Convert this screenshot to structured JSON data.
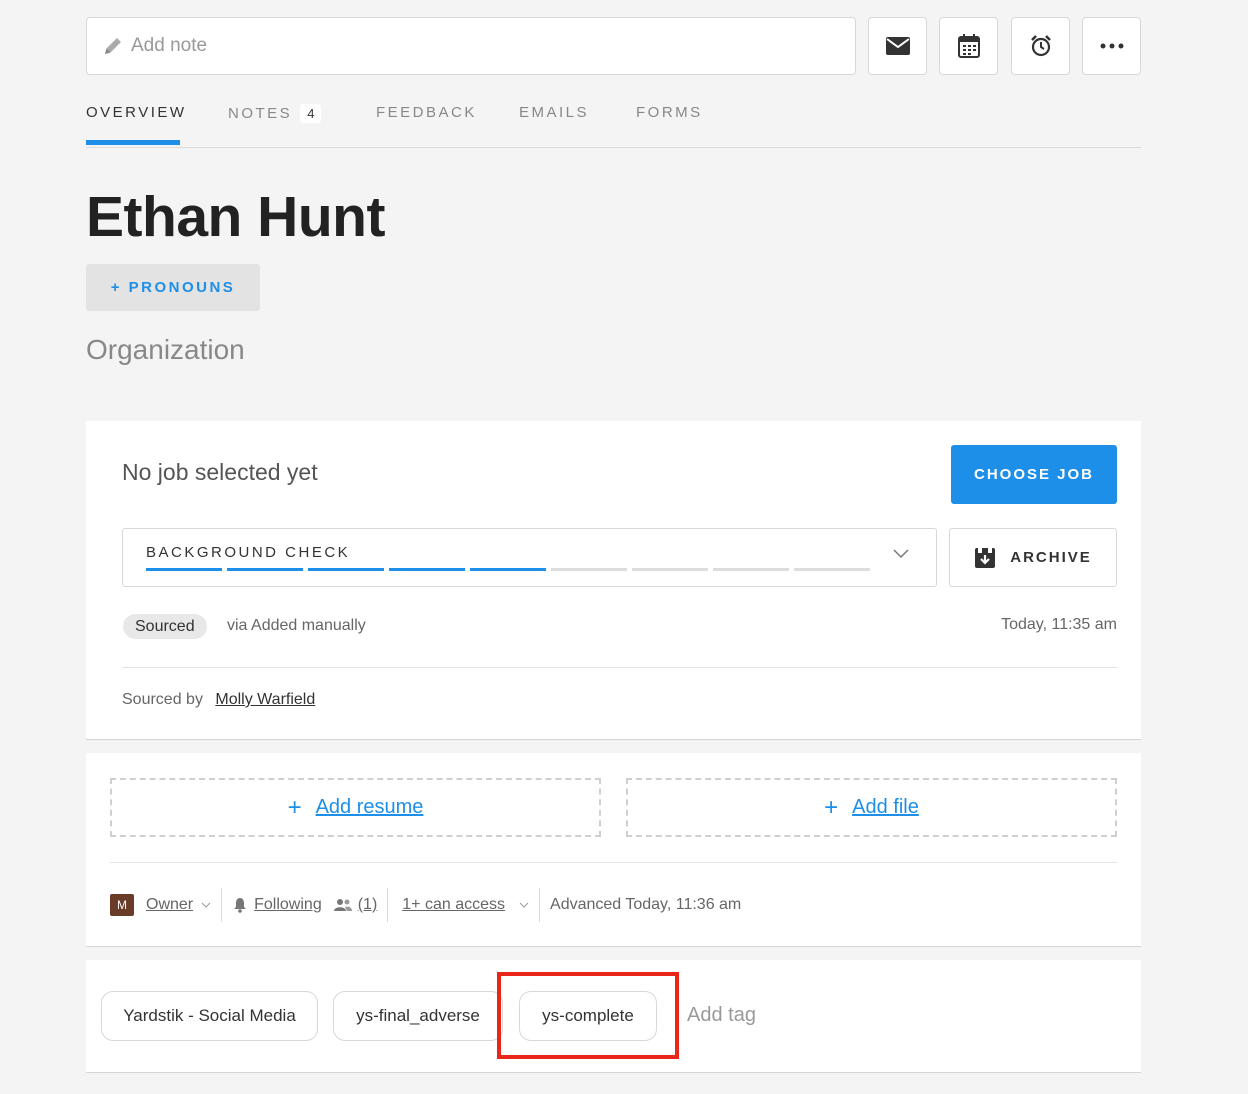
{
  "note_bar": {
    "placeholder": "Add note"
  },
  "toolbar": {
    "icons": [
      "email-icon",
      "calendar-icon",
      "alarm-icon",
      "more-icon"
    ]
  },
  "tabs": [
    {
      "label": "OVERVIEW",
      "active": true
    },
    {
      "label": "NOTES",
      "count": "4"
    },
    {
      "label": "FEEDBACK"
    },
    {
      "label": "EMAILS"
    },
    {
      "label": "FORMS"
    }
  ],
  "profile": {
    "name": "Ethan Hunt",
    "pronouns_button": "+ PRONOUNS",
    "organization": "Organization"
  },
  "job": {
    "status_text": "No job selected yet",
    "choose_button": "CHOOSE JOB",
    "stage_label": "BACKGROUND CHECK",
    "stage_progress": {
      "completed": 5,
      "total": 9
    },
    "archive_button": "ARCHIVE",
    "source_badge": "Sourced",
    "source_via": "via Added manually",
    "source_time": "Today, 11:35 am",
    "sourced_by_label": "Sourced by",
    "sourced_by_name": "Molly Warfield"
  },
  "files": {
    "add_resume": "Add resume",
    "add_file": "Add file"
  },
  "meta": {
    "avatar_initial": "M",
    "owner": "Owner",
    "following": "Following",
    "followers_count": "(1)",
    "access": "1+ can access",
    "advanced": "Advanced Today, 11:36 am"
  },
  "tags": {
    "items": [
      "Yardstik - Social Media",
      "ys-final_adverse",
      "ys-complete"
    ],
    "add_label": "Add tag"
  },
  "colors": {
    "accent": "#1d8fe8",
    "highlight": "#e8261a",
    "stage_incomplete": "#dddddd"
  }
}
